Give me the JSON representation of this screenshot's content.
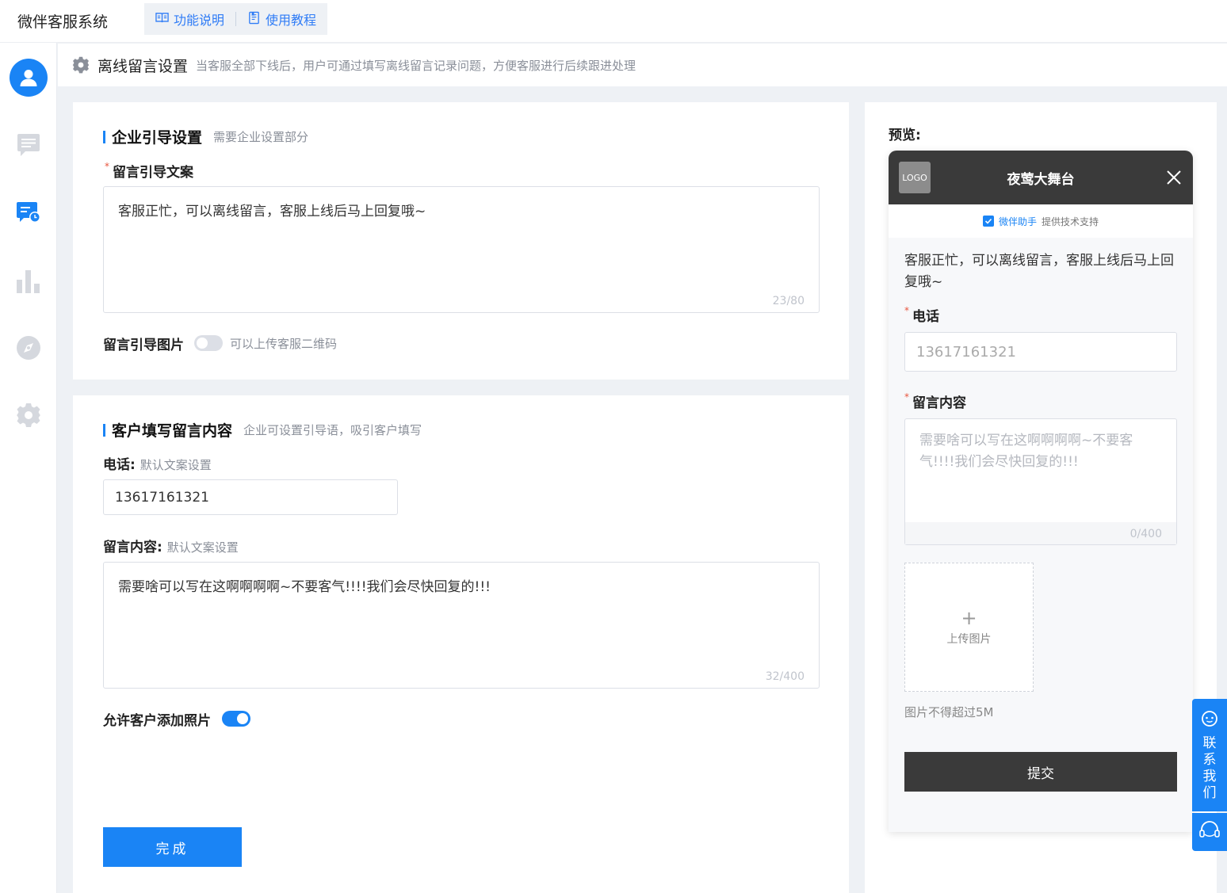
{
  "app": {
    "brand": "微伴客服系统",
    "nav": [
      {
        "label": "功能说明",
        "icon": "book-icon"
      },
      {
        "label": "使用教程",
        "icon": "document-icon"
      }
    ]
  },
  "sidebar": {
    "items": [
      {
        "name": "user-avatar",
        "icon": "user-icon",
        "active": true
      },
      {
        "name": "messages",
        "icon": "chat-icon"
      },
      {
        "name": "offline-message",
        "icon": "chat-clock-icon",
        "highlighted": true
      },
      {
        "name": "statistics",
        "icon": "bar-chart-icon"
      },
      {
        "name": "explore",
        "icon": "compass-icon"
      },
      {
        "name": "settings",
        "icon": "gear-icon"
      }
    ]
  },
  "header": {
    "title": "离线留言设置",
    "description": "当客服全部下线后，用户可通过填写离线留言记录问题，方便客服进行后续跟进处理"
  },
  "section_guide": {
    "title": "企业引导设置",
    "description": "需要企业设置部分",
    "copy_label": "留言引导文案",
    "copy_value": "客服正忙，可以离线留言，客服上线后马上回复哦~",
    "copy_counter": "23/80",
    "image_label": "留言引导图片",
    "image_enabled": false,
    "image_hint": "可以上传客服二维码"
  },
  "section_customer": {
    "title": "客户填写留言内容",
    "description": "企业可设置引导语，吸引客户填写",
    "phone_label": "电话:",
    "phone_hint": "默认文案设置",
    "phone_value": "13617161321",
    "content_label": "留言内容:",
    "content_hint": "默认文案设置",
    "content_value": "需要啥可以写在这啊啊啊啊~不要客气!!!!我们会尽快回复的!!!",
    "content_counter": "32/400",
    "allow_photo_label": "允许客户添加照片",
    "allow_photo_enabled": true,
    "done_button": "完成"
  },
  "preview": {
    "label": "预览:",
    "logo": "LOGO",
    "title": "夜莺大舞台",
    "support_brand": "微伴助手",
    "support_text": "提供技术支持",
    "message": "客服正忙，可以离线留言，客服上线后马上回复哦~",
    "phone_label": "电话",
    "phone_placeholder": "13617161321",
    "content_label": "留言内容",
    "content_placeholder": "需要啥可以写在这啊啊啊啊~不要客气!!!!我们会尽快回复的!!!",
    "content_counter": "0/400",
    "upload_label": "上传图片",
    "upload_hint": "图片不得超过5M",
    "submit_button": "提交"
  },
  "contact_float": {
    "label": "联系我们"
  },
  "colors": {
    "accent": "#1a84f5",
    "dark": "#3a3a3a",
    "required": "#e8553e"
  }
}
